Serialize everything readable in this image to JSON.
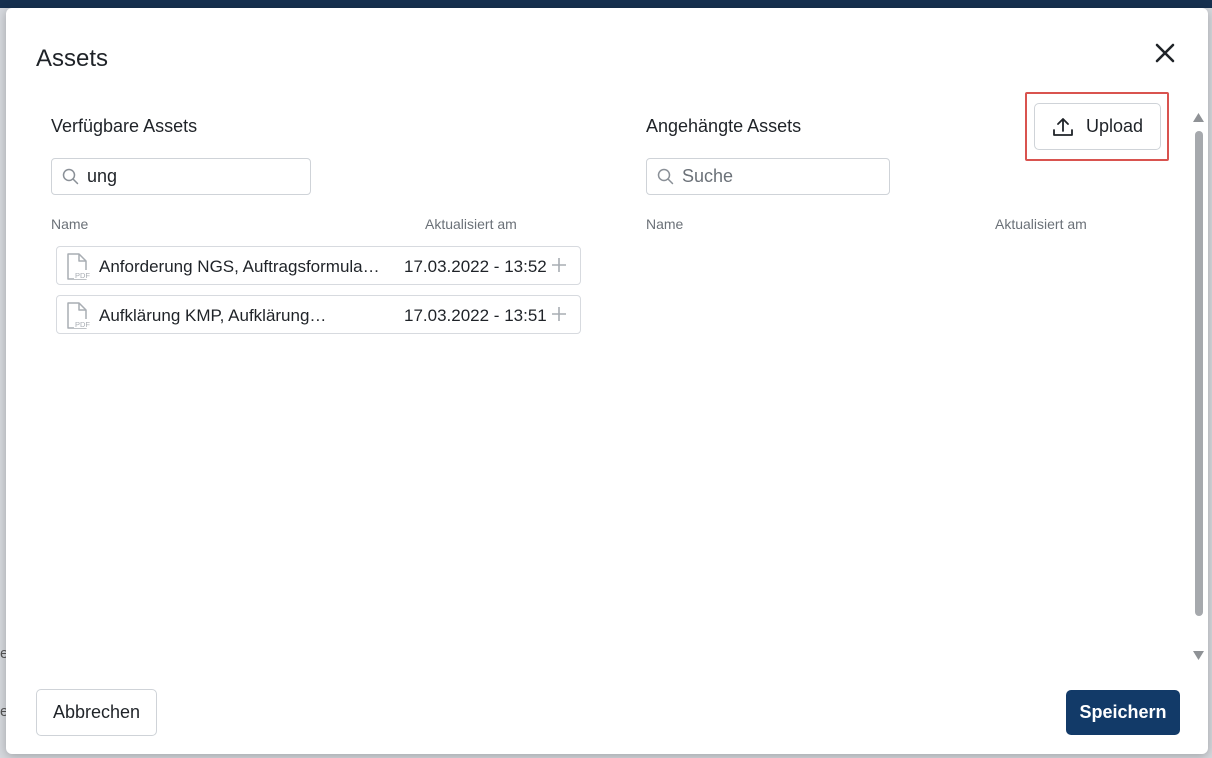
{
  "dialog": {
    "title": "Assets",
    "close_icon": "close-icon"
  },
  "available": {
    "title": "Verfügbare Assets",
    "search_value": "ung",
    "columns": {
      "name": "Name",
      "updated": "Aktualisiert am"
    },
    "items": [
      {
        "name": "Anforderung NGS, Auftragsformula…",
        "updated": "17.03.2022 - 13:52",
        "icon": "pdf-file-icon"
      },
      {
        "name": "Aufklärung KMP, Aufklärung…",
        "updated": "17.03.2022 - 13:51",
        "icon": "pdf-file-icon"
      }
    ]
  },
  "attached": {
    "title": "Angehängte Assets",
    "search_placeholder": "Suche",
    "columns": {
      "name": "Name",
      "updated": "Aktualisiert am"
    },
    "items": []
  },
  "upload": {
    "label": "Upload",
    "icon": "upload-icon"
  },
  "footer": {
    "cancel_label": "Abbrechen",
    "save_label": "Speichern"
  },
  "colors": {
    "primary": "#123a68",
    "highlight": "#d9534f",
    "topbar": "#16304f"
  }
}
